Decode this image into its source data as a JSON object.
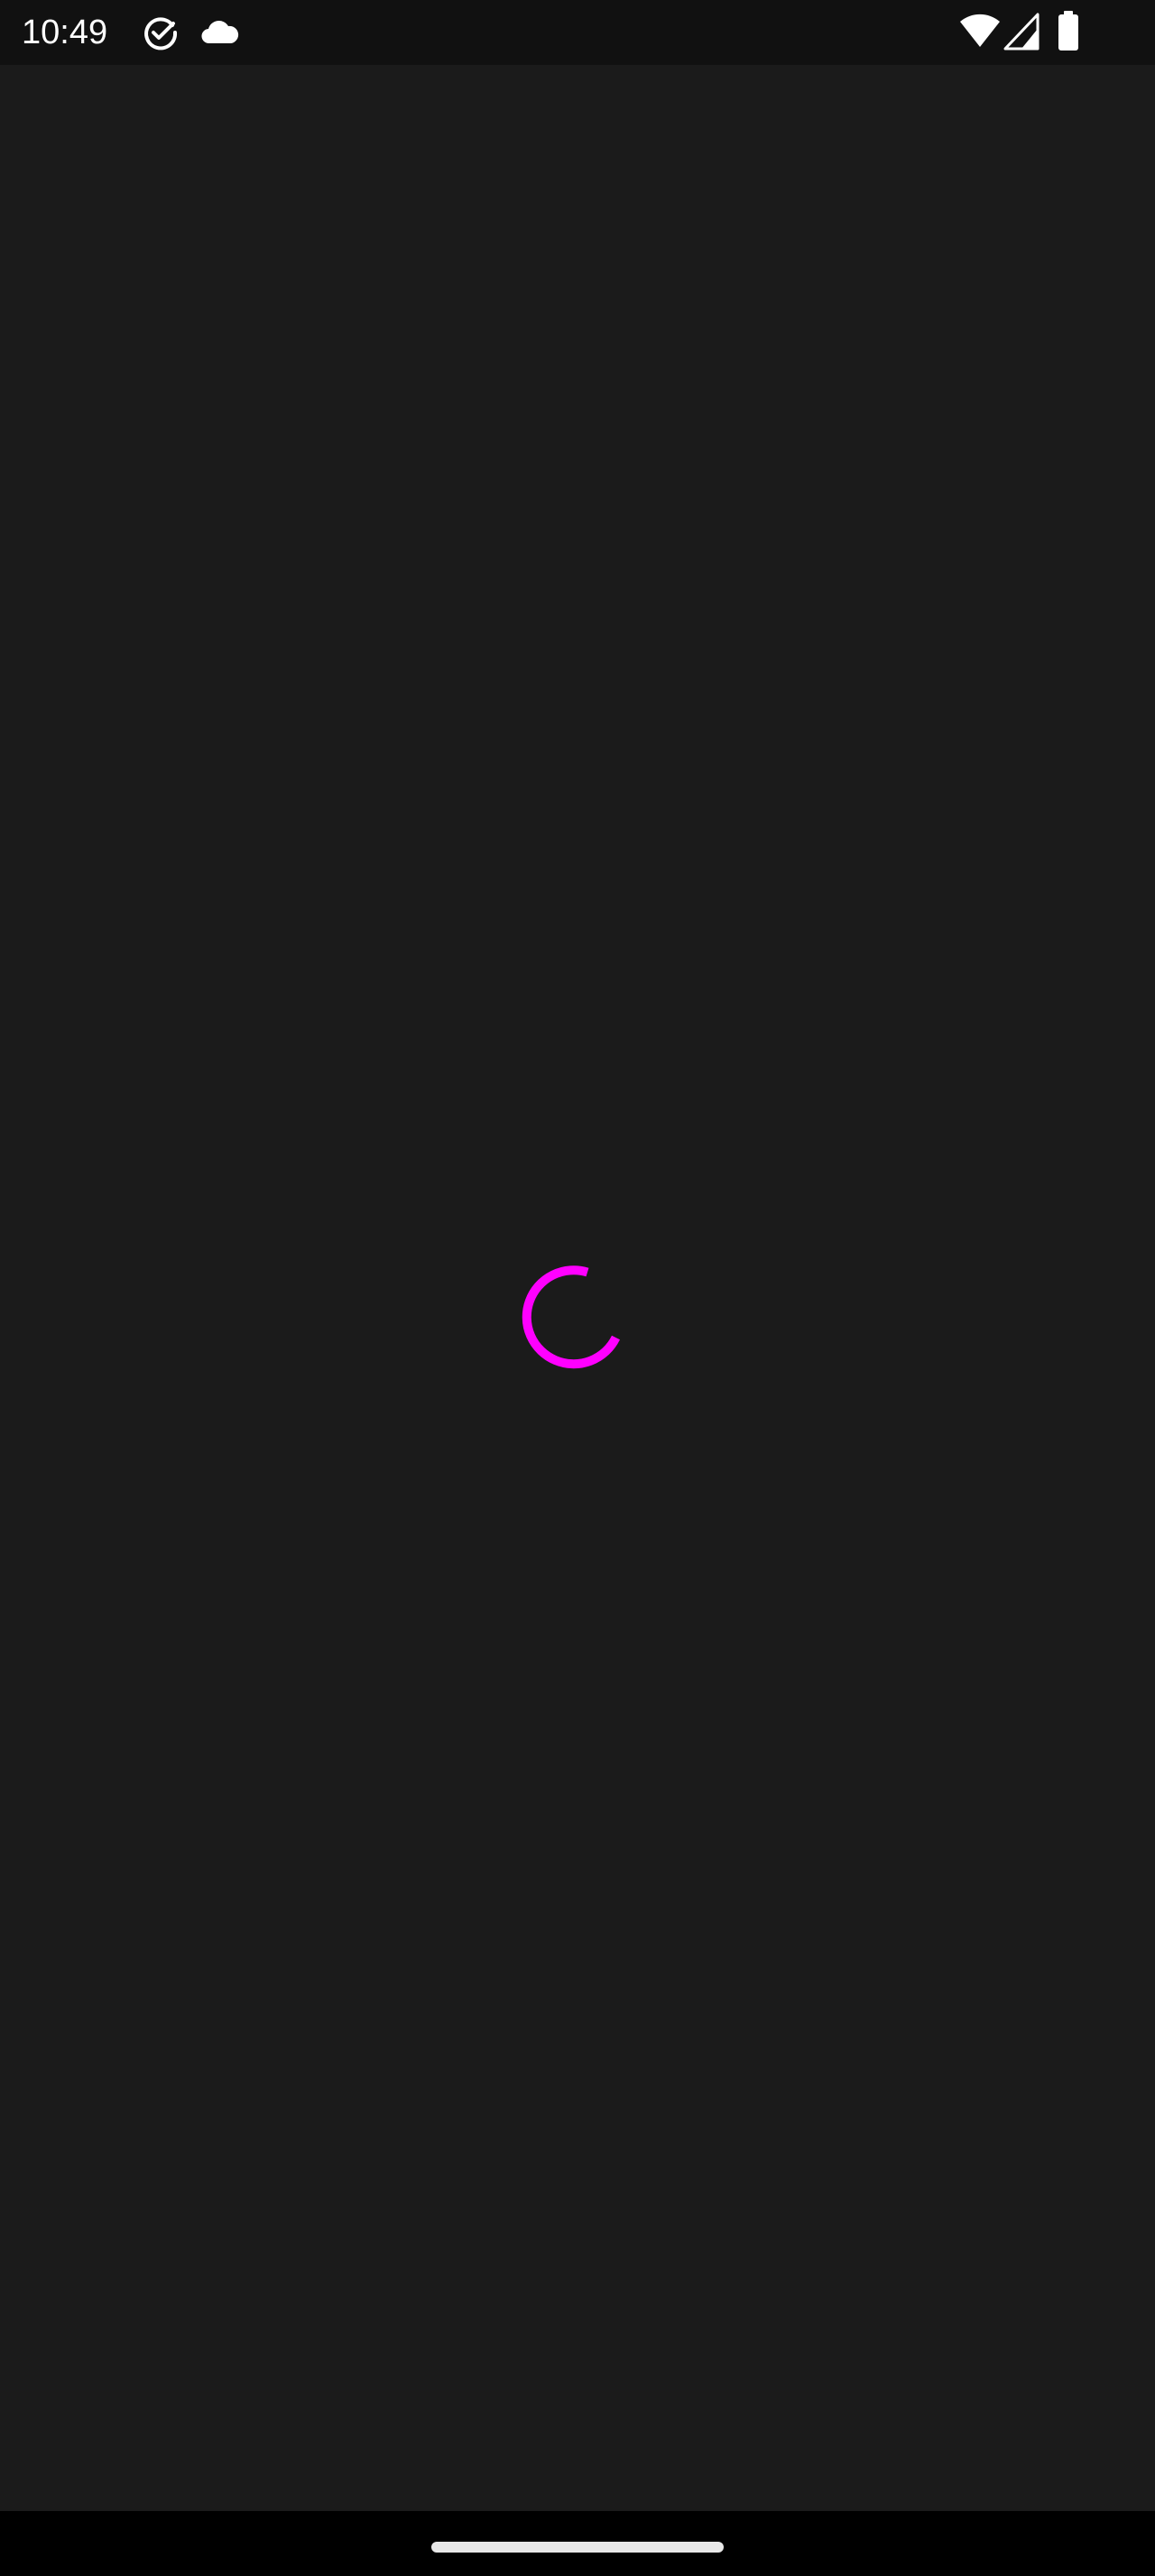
{
  "status_bar": {
    "time": "10:49",
    "icons": [
      "task-check-icon",
      "cloud-icon",
      "wifi-icon",
      "cellular-signal-icon",
      "battery-icon"
    ]
  },
  "main": {
    "state": "loading",
    "spinner_color": "#ff00ff"
  },
  "nav_bar": {
    "handle": "gesture-home-handle"
  },
  "colors": {
    "background": "#1b1b1b",
    "status_bar": "#111111",
    "nav_bar": "#000000"
  }
}
